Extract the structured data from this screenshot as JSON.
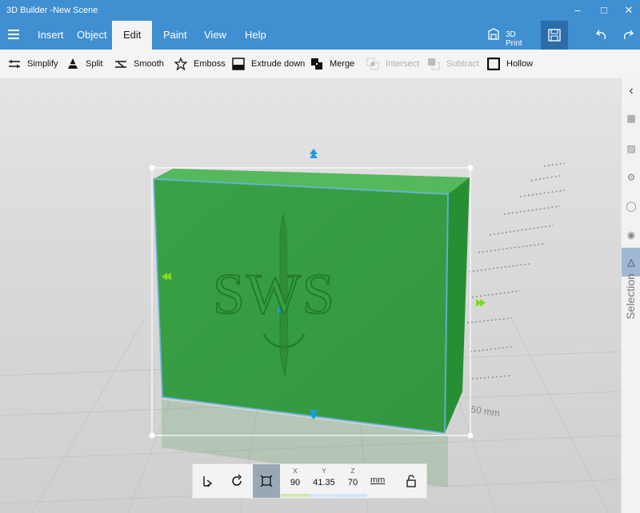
{
  "window": {
    "title": "3D Builder -New Scene",
    "controls": [
      "minimize",
      "maximize",
      "close"
    ]
  },
  "ribbon": {
    "tabs": [
      {
        "label": "Insert",
        "active": false
      },
      {
        "label": "Object",
        "active": false
      },
      {
        "label": "Edit",
        "active": true
      },
      {
        "label": "Paint",
        "active": false
      },
      {
        "label": "View",
        "active": false
      },
      {
        "label": "Help",
        "active": false
      }
    ],
    "print_label": "3D Print"
  },
  "toolbar": {
    "items": [
      {
        "label": "Simplify",
        "icon": "simplify-icon",
        "enabled": true
      },
      {
        "label": "Split",
        "icon": "split-icon",
        "enabled": true
      },
      {
        "label": "Smooth",
        "icon": "smooth-icon",
        "enabled": true
      },
      {
        "label": "Emboss",
        "icon": "star-icon",
        "enabled": true
      },
      {
        "label": "Extrude down",
        "icon": "extrude-down-icon",
        "enabled": true
      },
      {
        "label": "Merge",
        "icon": "merge-icon",
        "enabled": true
      },
      {
        "label": "Intersect",
        "icon": "intersect-icon",
        "enabled": false
      },
      {
        "label": "Subtract",
        "icon": "subtract-icon",
        "enabled": false
      },
      {
        "label": "Hollow",
        "icon": "hollow-icon",
        "enabled": true
      }
    ]
  },
  "scene": {
    "model_color": "#3a9a42",
    "emboss_text": "SWS",
    "ruler_label": "50 mm"
  },
  "side_panel": {
    "label": "Selection"
  },
  "bottom_bar": {
    "dims": [
      {
        "axis": "X",
        "value": "90",
        "color": "#cfe9b0"
      },
      {
        "axis": "Y",
        "value": "41.35",
        "color": "#d8e6f4"
      },
      {
        "axis": "Z",
        "value": "70",
        "color": "#cfe2f8"
      }
    ],
    "unit": "mm"
  },
  "colors": {
    "accent": "#3f8fd1",
    "selection": "#1e9be0",
    "handle_green": "#7fd82a"
  }
}
